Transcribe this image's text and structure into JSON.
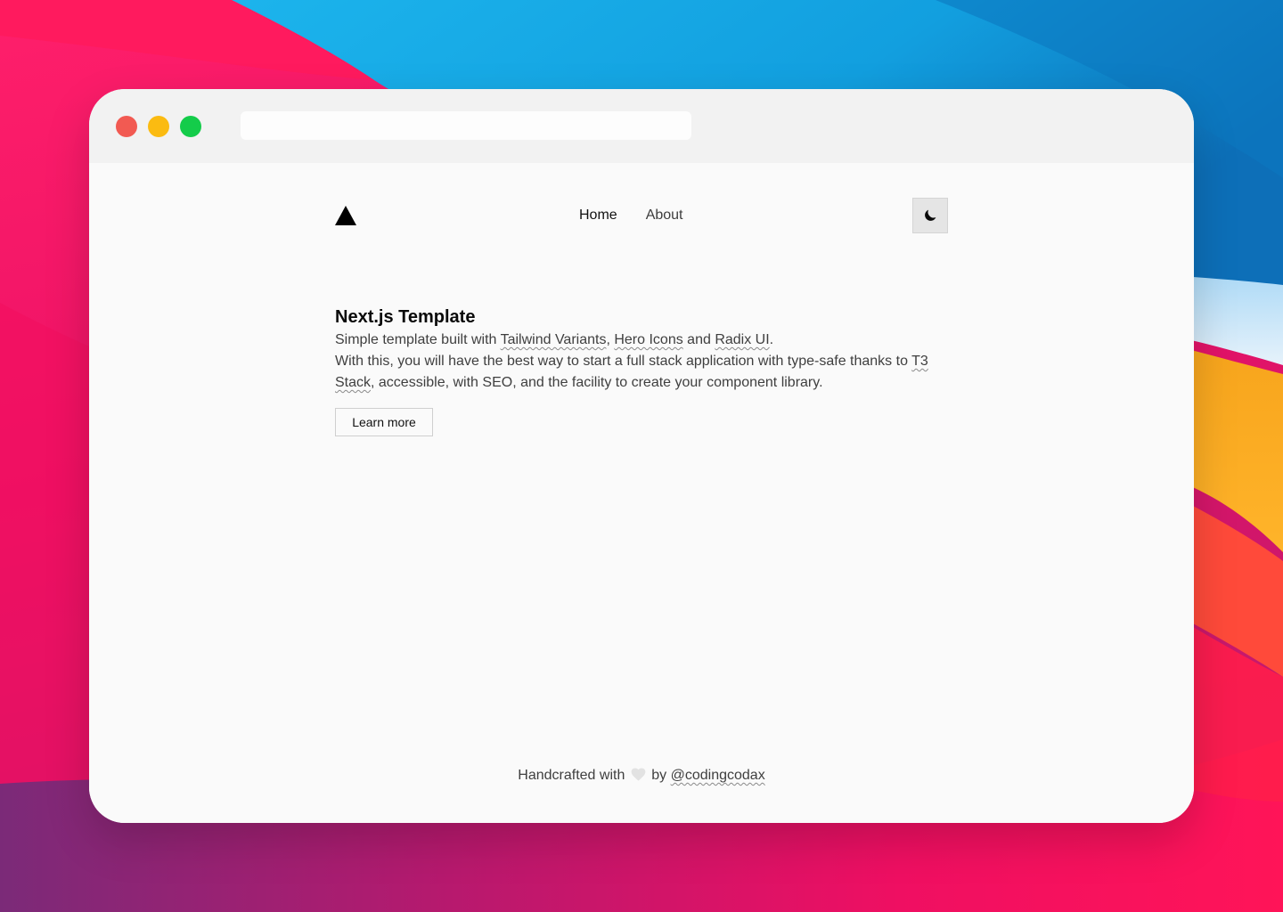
{
  "window": {
    "address_bar_value": "",
    "traffic_lights": {
      "close_color": "#f25a52",
      "minimize_color": "#fbbb11",
      "zoom_color": "#14cc4a"
    }
  },
  "nav": {
    "logo_icon": "triangle-logo-icon",
    "links": [
      {
        "label": "Home",
        "active": true
      },
      {
        "label": "About",
        "active": false
      }
    ],
    "theme_toggle_icon": "moon-icon"
  },
  "hero": {
    "title": "Next.js Template",
    "line1": {
      "prefix": "Simple template built with ",
      "link1": "Tailwind Variants",
      "sep": ", ",
      "link2": "Hero Icons",
      "and": " and ",
      "link3": "Radix UI",
      "suffix": "."
    },
    "line2": {
      "prefix": "With this, you will have the best way to start a full stack application with type-safe thanks to ",
      "link": "T3 Stack",
      "suffix": ", accessible, with SEO, and the facility to create your component library."
    },
    "button_label": "Learn more"
  },
  "footer": {
    "prefix": "Handcrafted with",
    "heart_icon": "heart-icon",
    "by": "by",
    "link": "@codingcodax"
  }
}
